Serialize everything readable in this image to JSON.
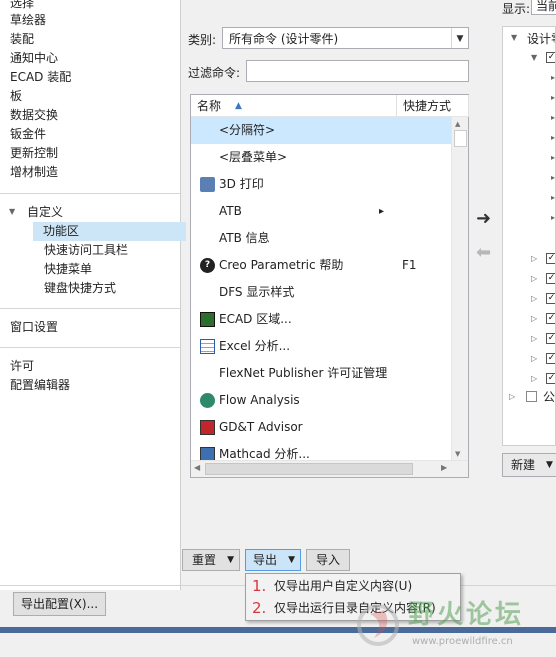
{
  "left_nav": {
    "items_top": [
      "选择",
      "草绘器",
      "装配",
      "通知中心",
      "ECAD 装配",
      "板",
      "数据交换",
      "钣金件",
      "更新控制",
      "增材制造"
    ],
    "customize": {
      "label": "自定义",
      "children": [
        "功能区",
        "快速访问工具栏",
        "快捷菜单",
        "键盘快捷方式"
      ],
      "selected": "功能区"
    },
    "window_settings": "窗口设置",
    "items_bottom": [
      "许可",
      "配置编辑器"
    ]
  },
  "filters": {
    "category_label": "类别:",
    "category_value": "所有命令 (设计零件)",
    "filter_label": "过滤命令:",
    "filter_value": ""
  },
  "command_list": {
    "col_name": "名称",
    "col_shortcut": "快捷方式",
    "rows": [
      {
        "label": "<分隔符>",
        "shortcut": "",
        "selected": true,
        "icon": "none"
      },
      {
        "label": "<层叠菜单>",
        "shortcut": "",
        "icon": "none"
      },
      {
        "label": "3D 打印",
        "shortcut": "",
        "icon": "printer-icon"
      },
      {
        "label": "ATB",
        "shortcut": "",
        "icon": "none",
        "submenu": "▸"
      },
      {
        "label": "ATB 信息",
        "shortcut": "",
        "icon": "none"
      },
      {
        "label": "Creo Parametric 帮助",
        "shortcut": "F1",
        "icon": "help-icon"
      },
      {
        "label": "DFS 显示样式",
        "shortcut": "",
        "icon": "none"
      },
      {
        "label": "ECAD 区域...",
        "shortcut": "",
        "icon": "ecad-icon"
      },
      {
        "label": "Excel 分析...",
        "shortcut": "",
        "icon": "excel-icon"
      },
      {
        "label": "FlexNet Publisher 许可证管理",
        "shortcut": "",
        "icon": "none"
      },
      {
        "label": "Flow Analysis",
        "shortcut": "",
        "icon": "flow-icon"
      },
      {
        "label": "GD&T Advisor",
        "shortcut": "",
        "icon": "gdt-icon"
      },
      {
        "label": "Mathcad 分析...",
        "shortcut": "",
        "icon": "mathcad-icon"
      }
    ]
  },
  "buttons": {
    "reset": "重置",
    "export": "导出",
    "import": "导入",
    "export_config": "导出配置(X)...",
    "new": "新建"
  },
  "right_panel": {
    "display_label": "显示:",
    "display_value": "当前",
    "root_label": "设计零",
    "last_label": "公"
  },
  "popup_menu": {
    "items": [
      {
        "num": "1.",
        "label": "仅导出用户自定义内容(U)"
      },
      {
        "num": "2.",
        "label": "仅导出运行目录自定义内容(R)"
      }
    ]
  },
  "arrows": {
    "right": "➜",
    "left": "⬅"
  },
  "watermark": {
    "text": "野火论坛",
    "url": "www.proewildfire.cn"
  }
}
